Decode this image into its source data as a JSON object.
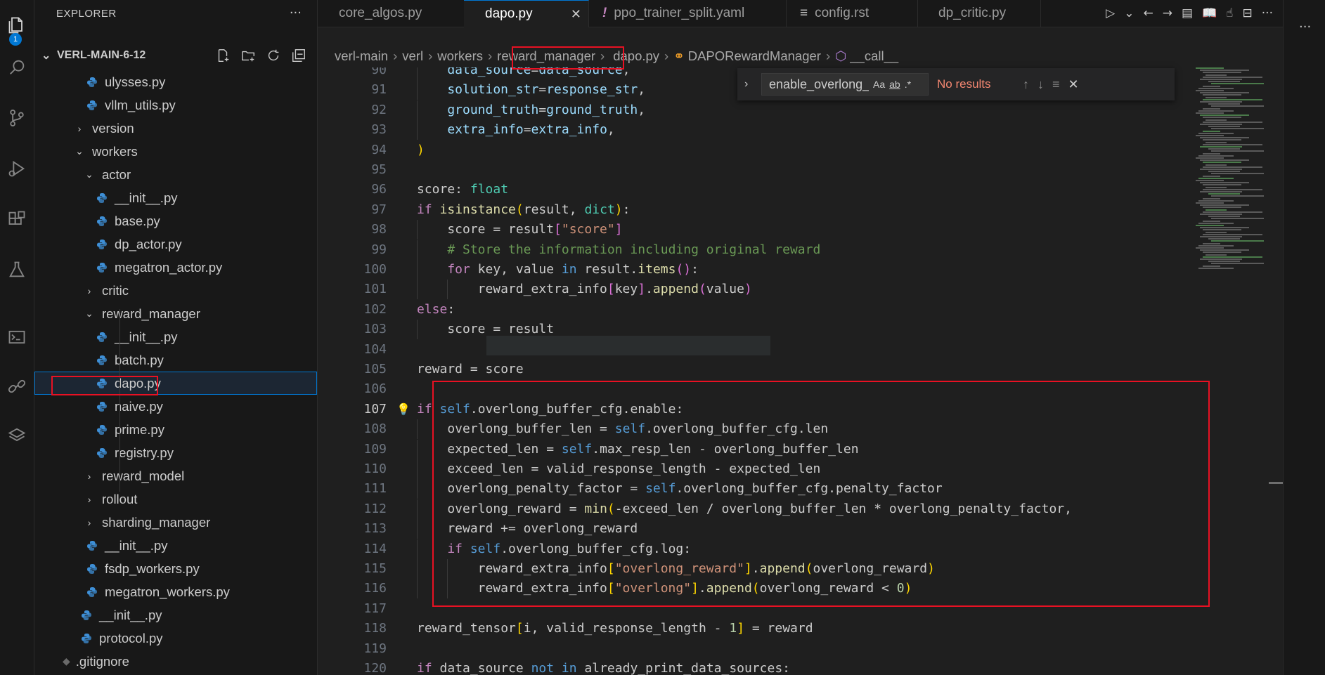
{
  "activity_bar": {
    "explorer_badge": "1",
    "icons": [
      "files-icon",
      "search-icon",
      "source-control-icon",
      "run-debug-icon",
      "extensions-icon",
      "testing-icon",
      "terminal-icon",
      "remote-link-icon",
      "layers-icon"
    ]
  },
  "sidebar": {
    "title": "EXPLORER",
    "more": "···",
    "project": "VERL-MAIN-6-12",
    "tree": [
      {
        "label": "ulysses.py",
        "kind": "file"
      },
      {
        "label": "vllm_utils.py",
        "kind": "file"
      },
      {
        "label": "version",
        "kind": "folder-closed"
      },
      {
        "label": "workers",
        "kind": "folder-open"
      },
      {
        "label": "actor",
        "kind": "folder-open"
      },
      {
        "label": "__init__.py",
        "kind": "file"
      },
      {
        "label": "base.py",
        "kind": "file"
      },
      {
        "label": "dp_actor.py",
        "kind": "file"
      },
      {
        "label": "megatron_actor.py",
        "kind": "file"
      },
      {
        "label": "critic",
        "kind": "folder-closed"
      },
      {
        "label": "reward_manager",
        "kind": "folder-open"
      },
      {
        "label": "__init__.py",
        "kind": "file"
      },
      {
        "label": "batch.py",
        "kind": "file"
      },
      {
        "label": "dapo.py",
        "kind": "file",
        "selected": true
      },
      {
        "label": "naive.py",
        "kind": "file"
      },
      {
        "label": "prime.py",
        "kind": "file"
      },
      {
        "label": "registry.py",
        "kind": "file"
      },
      {
        "label": "reward_model",
        "kind": "folder-closed"
      },
      {
        "label": "rollout",
        "kind": "folder-closed"
      },
      {
        "label": "sharding_manager",
        "kind": "folder-closed"
      },
      {
        "label": "__init__.py",
        "kind": "file"
      },
      {
        "label": "fsdp_workers.py",
        "kind": "file"
      },
      {
        "label": "megatron_workers.py",
        "kind": "file"
      },
      {
        "label": "__init__.py",
        "kind": "file"
      },
      {
        "label": "protocol.py",
        "kind": "file"
      },
      {
        "label": ".gitignore",
        "kind": "other"
      }
    ]
  },
  "tabs": [
    {
      "label": "core_algos.py",
      "icon": "python"
    },
    {
      "label": "dapo.py",
      "icon": "python",
      "active": true
    },
    {
      "label": "ppo_trainer_split.yaml",
      "icon": "yaml"
    },
    {
      "label": "config.rst",
      "icon": "text"
    },
    {
      "label": "dp_critic.py",
      "icon": "python"
    }
  ],
  "breadcrumb": [
    "verl-main",
    "verl",
    "workers",
    "reward_manager",
    "dapo.py",
    "DAPORewardManager",
    "__call__"
  ],
  "find": {
    "query": "enable_overlong_buffer",
    "match_case": "Aa",
    "whole_word": "ab",
    "regex": ".*",
    "status": "No results"
  },
  "code": {
    "current_line": 107,
    "lines": [
      {
        "n": 90,
        "tokens": [
          [
            "var",
            "data_source"
          ],
          [
            "plain",
            "="
          ],
          [
            "var",
            "data_source"
          ],
          [
            "plain",
            ","
          ]
        ],
        "indent": 2
      },
      {
        "n": 91,
        "tokens": [
          [
            "var",
            "solution_str"
          ],
          [
            "plain",
            "="
          ],
          [
            "var",
            "response_str"
          ],
          [
            "plain",
            ","
          ]
        ],
        "indent": 2
      },
      {
        "n": 92,
        "tokens": [
          [
            "var",
            "ground_truth"
          ],
          [
            "plain",
            "="
          ],
          [
            "var",
            "ground_truth"
          ],
          [
            "plain",
            ","
          ]
        ],
        "indent": 2
      },
      {
        "n": 93,
        "tokens": [
          [
            "var",
            "extra_info"
          ],
          [
            "plain",
            "="
          ],
          [
            "var",
            "extra_info"
          ],
          [
            "plain",
            ","
          ]
        ],
        "indent": 2
      },
      {
        "n": 94,
        "tokens": [
          [
            "paren",
            ")"
          ]
        ],
        "indent": 1
      },
      {
        "n": 95,
        "tokens": [],
        "indent": 1
      },
      {
        "n": 96,
        "tokens": [
          [
            "plain",
            "score: "
          ],
          [
            "type",
            "float"
          ]
        ],
        "indent": 1
      },
      {
        "n": 97,
        "tokens": [
          [
            "kw",
            "if "
          ],
          [
            "fn",
            "isinstance"
          ],
          [
            "paren",
            "("
          ],
          [
            "plain",
            "result, "
          ],
          [
            "type",
            "dict"
          ],
          [
            "paren",
            ")"
          ],
          [
            "plain",
            ":"
          ]
        ],
        "indent": 1
      },
      {
        "n": 98,
        "tokens": [
          [
            "plain",
            "score = result"
          ],
          [
            "paren2",
            "["
          ],
          [
            "str",
            "\"score\""
          ],
          [
            "paren2",
            "]"
          ]
        ],
        "indent": 2
      },
      {
        "n": 99,
        "tokens": [
          [
            "com",
            "# Store the information including original reward"
          ]
        ],
        "indent": 2
      },
      {
        "n": 100,
        "tokens": [
          [
            "kw",
            "for "
          ],
          [
            "plain",
            "key, value "
          ],
          [
            "kw2",
            "in "
          ],
          [
            "plain",
            "result."
          ],
          [
            "fn",
            "items"
          ],
          [
            "paren2",
            "()"
          ],
          [
            "plain",
            ":"
          ]
        ],
        "indent": 2
      },
      {
        "n": 101,
        "tokens": [
          [
            "plain",
            "reward_extra_info"
          ],
          [
            "paren2",
            "["
          ],
          [
            "plain",
            "key"
          ],
          [
            "paren2",
            "]"
          ],
          [
            "plain",
            "."
          ],
          [
            "fn",
            "append"
          ],
          [
            "paren2",
            "("
          ],
          [
            "plain",
            "value"
          ],
          [
            "paren2",
            ")"
          ]
        ],
        "indent": 3
      },
      {
        "n": 102,
        "tokens": [
          [
            "kw",
            "else"
          ],
          [
            "plain",
            ":"
          ]
        ],
        "indent": 1
      },
      {
        "n": 103,
        "tokens": [
          [
            "plain",
            "score = result"
          ]
        ],
        "indent": 2
      },
      {
        "n": 104,
        "tokens": [],
        "indent": 1
      },
      {
        "n": 105,
        "tokens": [
          [
            "plain",
            "reward = score"
          ]
        ],
        "indent": 1
      },
      {
        "n": 106,
        "tokens": [],
        "indent": 1
      },
      {
        "n": 107,
        "tokens": [
          [
            "kw",
            "if "
          ],
          [
            "kw2",
            "self"
          ],
          [
            "plain",
            ".overlong_buffer_cfg.enable:"
          ]
        ],
        "indent": 1
      },
      {
        "n": 108,
        "tokens": [
          [
            "plain",
            "overlong_buffer_len = "
          ],
          [
            "kw2",
            "self"
          ],
          [
            "plain",
            ".overlong_buffer_cfg.len"
          ]
        ],
        "indent": 2
      },
      {
        "n": 109,
        "tokens": [
          [
            "plain",
            "expected_len = "
          ],
          [
            "kw2",
            "self"
          ],
          [
            "plain",
            ".max_resp_len - overlong_buffer_len"
          ]
        ],
        "indent": 2
      },
      {
        "n": 110,
        "tokens": [
          [
            "plain",
            "exceed_len = valid_response_length - expected_len"
          ]
        ],
        "indent": 2
      },
      {
        "n": 111,
        "tokens": [
          [
            "plain",
            "overlong_penalty_factor = "
          ],
          [
            "kw2",
            "self"
          ],
          [
            "plain",
            ".overlong_buffer_cfg.penalty_factor"
          ]
        ],
        "indent": 2
      },
      {
        "n": 112,
        "tokens": [
          [
            "plain",
            "overlong_reward = "
          ],
          [
            "fn",
            "min"
          ],
          [
            "paren",
            "("
          ],
          [
            "plain",
            "-exceed_len / overlong_buffer_len * overlong_penalty_factor,"
          ]
        ],
        "indent": 2
      },
      {
        "n": 113,
        "tokens": [
          [
            "plain",
            "reward += overlong_reward"
          ]
        ],
        "indent": 2
      },
      {
        "n": 114,
        "tokens": [
          [
            "kw",
            "if "
          ],
          [
            "kw2",
            "self"
          ],
          [
            "plain",
            ".overlong_buffer_cfg.log:"
          ]
        ],
        "indent": 2
      },
      {
        "n": 115,
        "tokens": [
          [
            "plain",
            "reward_extra_info"
          ],
          [
            "paren",
            "["
          ],
          [
            "str",
            "\"overlong_reward\""
          ],
          [
            "paren",
            "]"
          ],
          [
            "plain",
            "."
          ],
          [
            "fn",
            "append"
          ],
          [
            "paren",
            "("
          ],
          [
            "plain",
            "overlong_reward"
          ],
          [
            "paren",
            ")"
          ]
        ],
        "indent": 3
      },
      {
        "n": 116,
        "tokens": [
          [
            "plain",
            "reward_extra_info"
          ],
          [
            "paren",
            "["
          ],
          [
            "str",
            "\"overlong\""
          ],
          [
            "paren",
            "]"
          ],
          [
            "plain",
            "."
          ],
          [
            "fn",
            "append"
          ],
          [
            "paren",
            "("
          ],
          [
            "plain",
            "overlong_reward < "
          ],
          [
            "num",
            "0"
          ],
          [
            "paren",
            ")"
          ]
        ],
        "indent": 3
      },
      {
        "n": 117,
        "tokens": [],
        "indent": 1
      },
      {
        "n": 118,
        "tokens": [
          [
            "plain",
            "reward_tensor"
          ],
          [
            "paren",
            "["
          ],
          [
            "plain",
            "i, valid_response_length - "
          ],
          [
            "num",
            "1"
          ],
          [
            "paren",
            "]"
          ],
          [
            "plain",
            " = reward"
          ]
        ],
        "indent": 1
      },
      {
        "n": 119,
        "tokens": [],
        "indent": 1
      },
      {
        "n": 120,
        "tokens": [
          [
            "kw",
            "if "
          ],
          [
            "plain",
            "data_source "
          ],
          [
            "kw2",
            "not in "
          ],
          [
            "plain",
            "already_print_data_sources:"
          ]
        ],
        "indent": 1
      }
    ]
  }
}
